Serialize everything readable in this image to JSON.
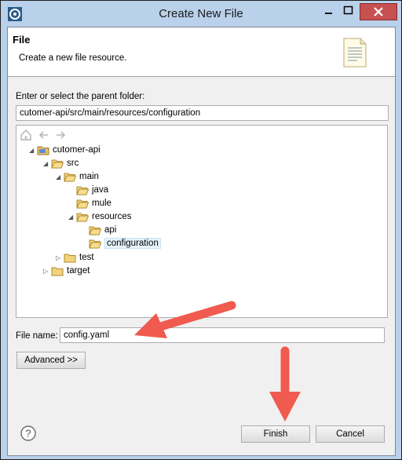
{
  "window": {
    "title": "Create New File",
    "accent": "#b9d1ea",
    "close_color": "#c75050"
  },
  "header": {
    "title": "File",
    "description": "Create a new file resource."
  },
  "parent": {
    "label": "Enter or select the parent folder:",
    "value": "cutomer-api/src/main/resources/configuration"
  },
  "tree": {
    "nodes": [
      {
        "label": "cutomer-api",
        "twisty": "◢",
        "icon": "project-icon"
      },
      {
        "label": "src",
        "twisty": "◢",
        "icon": "folder-icon"
      },
      {
        "label": "main",
        "twisty": "◢",
        "icon": "folder-icon"
      },
      {
        "label": "java",
        "twisty": "",
        "icon": "folder-icon"
      },
      {
        "label": "mule",
        "twisty": "",
        "icon": "folder-icon"
      },
      {
        "label": "resources",
        "twisty": "◢",
        "icon": "folder-icon"
      },
      {
        "label": "api",
        "twisty": "",
        "icon": "folder-icon"
      },
      {
        "label": "configuration",
        "twisty": "",
        "icon": "folder-icon",
        "selected": true
      },
      {
        "label": "test",
        "twisty": "▷",
        "icon": "folder-icon"
      },
      {
        "label": "target",
        "twisty": "▷",
        "icon": "folder-icon"
      }
    ]
  },
  "file": {
    "label": "File name:",
    "value": "config.yaml"
  },
  "buttons": {
    "advanced": "Advanced >>",
    "finish": "Finish",
    "cancel": "Cancel"
  },
  "annotation": {
    "arrow_color": "#f05a4f"
  }
}
